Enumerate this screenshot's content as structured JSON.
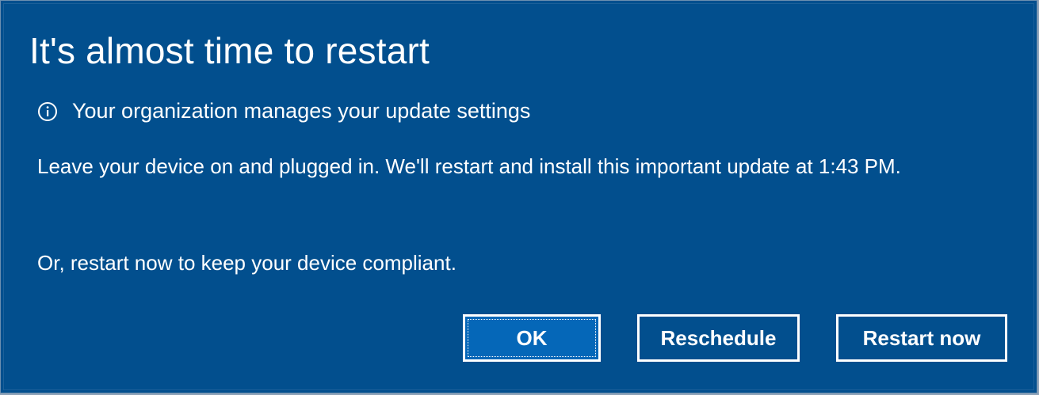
{
  "dialog": {
    "title": "It's almost time to restart",
    "notice": {
      "icon": "info-icon",
      "text": "Your organization manages your update settings"
    },
    "message_line": "Leave your device on and plugged in. We'll restart and install this important update at 1:43 PM.",
    "message_secondary": "Or, restart now to keep your device compliant.",
    "buttons": {
      "ok_label": "OK",
      "reschedule_label": "Reschedule",
      "restart_now_label": "Restart now"
    }
  },
  "colors": {
    "background": "#024f8e",
    "text": "#ffffff",
    "focused_button": "#0567b8"
  }
}
